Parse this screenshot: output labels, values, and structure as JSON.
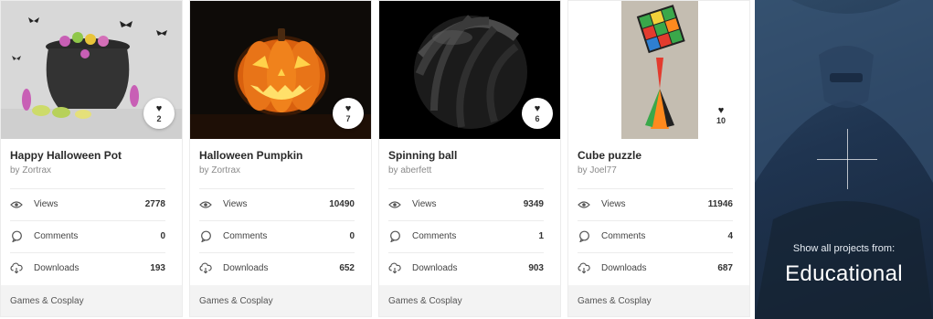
{
  "cards": [
    {
      "title": "Happy Halloween Pot",
      "author": "by Zortrax",
      "likes": "2",
      "views_label": "Views",
      "views": "2778",
      "comments_label": "Comments",
      "comments": "0",
      "downloads_label": "Downloads",
      "downloads": "193",
      "category": "Games & Cosplay"
    },
    {
      "title": "Halloween Pumpkin",
      "author": "by Zortrax",
      "likes": "7",
      "views_label": "Views",
      "views": "10490",
      "comments_label": "Comments",
      "comments": "0",
      "downloads_label": "Downloads",
      "downloads": "652",
      "category": "Games & Cosplay"
    },
    {
      "title": "Spinning ball",
      "author": "by aberfett",
      "likes": "6",
      "views_label": "Views",
      "views": "9349",
      "comments_label": "Comments",
      "comments": "1",
      "downloads_label": "Downloads",
      "downloads": "903",
      "category": "Games & Cosplay"
    },
    {
      "title": "Cube puzzle",
      "author": "by Joel77",
      "likes": "10",
      "views_label": "Views",
      "views": "11946",
      "comments_label": "Comments",
      "comments": "4",
      "downloads_label": "Downloads",
      "downloads": "687",
      "category": "Games & Cosplay"
    }
  ],
  "promo": {
    "small_text": "Show all projects from:",
    "big_text": "Educational"
  },
  "icons": {
    "likes": "heart-icon",
    "views": "eye-icon",
    "comments": "comment-icon",
    "downloads": "cloud-download-icon"
  },
  "colors": {
    "promo_background": "#1f3450",
    "category_background": "#f3f3f3",
    "pumpkin_orange": "#f07a1a"
  }
}
